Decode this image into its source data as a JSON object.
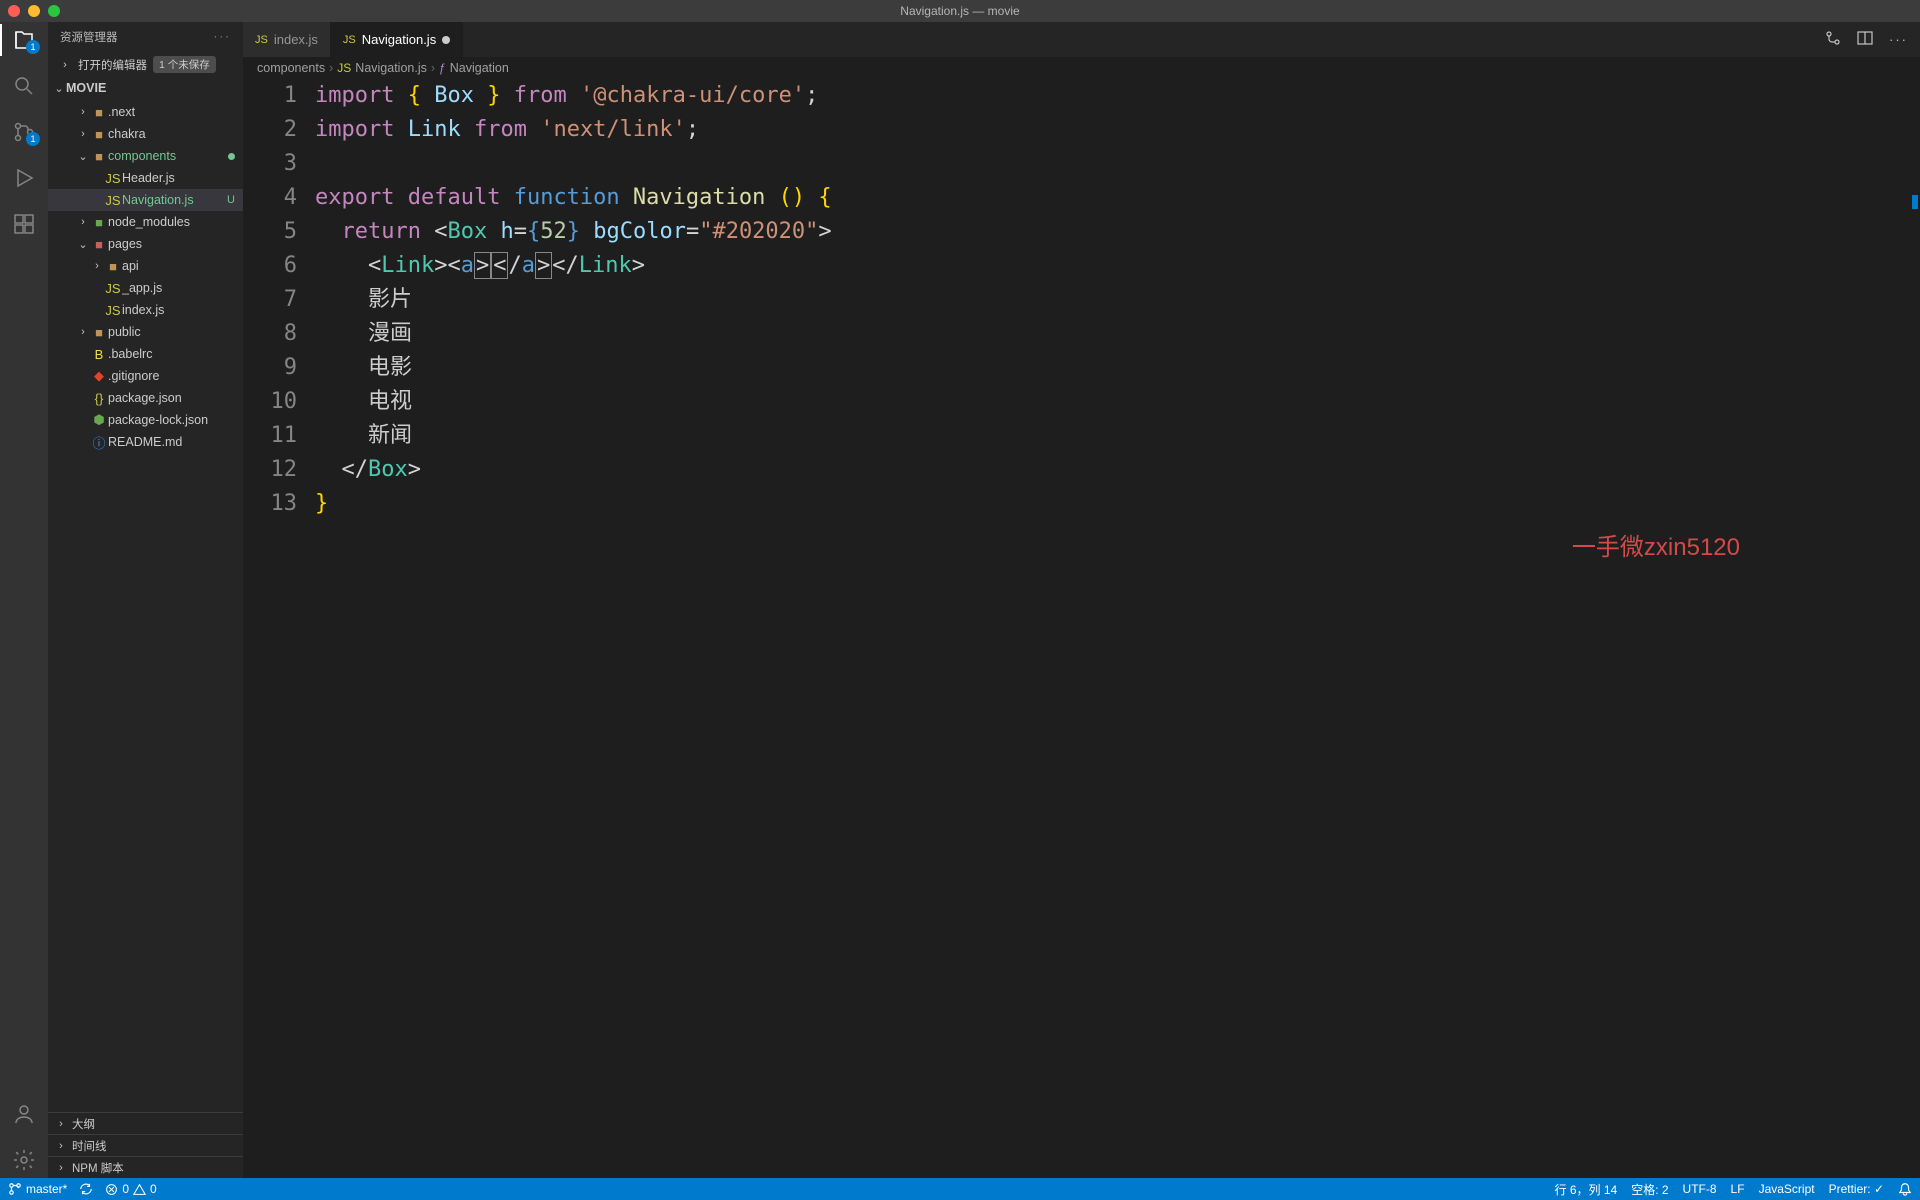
{
  "title": "Navigation.js — movie",
  "activitybar": {
    "explorer_badge": "1",
    "scm_badge": "1"
  },
  "sidebar": {
    "title": "资源管理器",
    "open_editors_label": "打开的编辑器",
    "unsaved_label": "1 个未保存",
    "project": "MOVIE",
    "tree": [
      {
        "type": "folder",
        "label": ".next",
        "indent": 2
      },
      {
        "type": "folder",
        "label": "chakra",
        "indent": 2
      },
      {
        "type": "folder",
        "label": "components",
        "indent": 2,
        "expanded": true,
        "modified": true
      },
      {
        "type": "file",
        "label": "Header.js",
        "indent": 3,
        "icon": "js"
      },
      {
        "type": "file",
        "label": "Navigation.js",
        "indent": 3,
        "icon": "js",
        "active": true,
        "status": "U"
      },
      {
        "type": "folder",
        "label": "node_modules",
        "indent": 2,
        "green": true
      },
      {
        "type": "folder",
        "label": "pages",
        "indent": 2,
        "expanded": true,
        "red": true
      },
      {
        "type": "folder",
        "label": "api",
        "indent": 3
      },
      {
        "type": "file",
        "label": "_app.js",
        "indent": 3,
        "icon": "js"
      },
      {
        "type": "file",
        "label": "index.js",
        "indent": 3,
        "icon": "js"
      },
      {
        "type": "folder",
        "label": "public",
        "indent": 2
      },
      {
        "type": "file",
        "label": ".babelrc",
        "indent": 2,
        "icon": "babel"
      },
      {
        "type": "file",
        "label": ".gitignore",
        "indent": 2,
        "icon": "git"
      },
      {
        "type": "file",
        "label": "package.json",
        "indent": 2,
        "icon": "json"
      },
      {
        "type": "file",
        "label": "package-lock.json",
        "indent": 2,
        "icon": "lock"
      },
      {
        "type": "file",
        "label": "README.md",
        "indent": 2,
        "icon": "info"
      }
    ],
    "sections": [
      "大纲",
      "时间线",
      "NPM 脚本"
    ]
  },
  "tabs": [
    {
      "label": "index.js",
      "icon": "js",
      "active": false,
      "dirty": false
    },
    {
      "label": "Navigation.js",
      "icon": "js",
      "active": true,
      "dirty": true
    }
  ],
  "breadcrumbs": {
    "items": [
      "components",
      "Navigation.js",
      "Navigation"
    ]
  },
  "code_lines": {
    "l7": "影片",
    "l8": "漫画",
    "l9": "电影",
    "l10": "电视",
    "l11": "新闻"
  },
  "code_tokens": {
    "import": "import",
    "export": "export",
    "default": "default",
    "function": "function",
    "return": "return",
    "from": "from",
    "Box": "Box",
    "Link": "Link",
    "Navigation": "Navigation",
    "a": "a",
    "h": "h",
    "bgColor": "bgColor",
    "num52": "52",
    "color": "\"#202020\"",
    "chakra": "'@chakra-ui/core'",
    "nextlink": "'next/link'"
  },
  "watermark": "一手微zxin5120",
  "statusbar": {
    "branch": "master*",
    "sync": "",
    "errors": "0",
    "warnings": "0",
    "cursor": "行 6，列 14",
    "spaces": "空格: 2",
    "encoding": "UTF-8",
    "eol": "LF",
    "lang": "JavaScript",
    "prettier": "Prettier: ✓"
  }
}
